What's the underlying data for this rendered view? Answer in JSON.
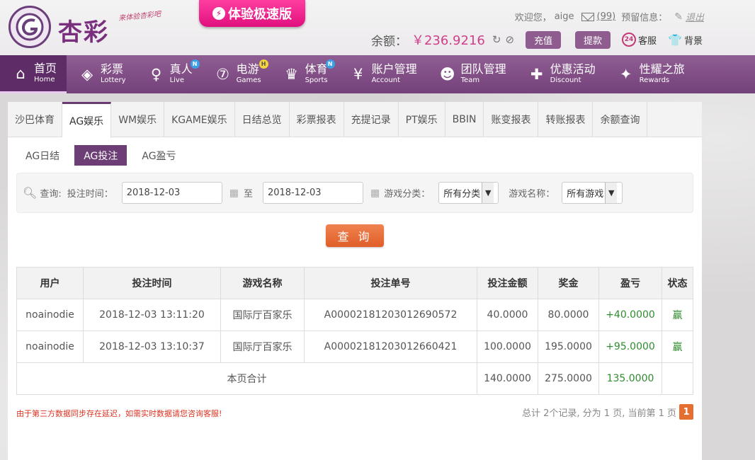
{
  "header": {
    "brand": "杏彩",
    "slogan": "来体验杏彩吧",
    "promo": "体验极速版",
    "welcome": "欢迎您，",
    "username": "aige",
    "mail_count": "(99)",
    "reserve_label": "预留信息：",
    "logout": "退出",
    "balance_label": "余额：",
    "balance_value": "￥236.9216",
    "recharge": "充值",
    "withdraw": "提款",
    "service": "客服",
    "background": "背景"
  },
  "nav": [
    {
      "cn": "首页",
      "en": "Home",
      "icon": "home-icon"
    },
    {
      "cn": "彩票",
      "en": "Lottery",
      "icon": "lottery-icon"
    },
    {
      "cn": "真人",
      "en": "Live",
      "icon": "live-icon",
      "badge": "N"
    },
    {
      "cn": "电游",
      "en": "Games",
      "icon": "games-icon",
      "badge": "H"
    },
    {
      "cn": "体育",
      "en": "Sports",
      "icon": "trophy-icon",
      "badge": "N"
    },
    {
      "cn": "账户管理",
      "en": "Account",
      "icon": "yen-icon"
    },
    {
      "cn": "团队管理",
      "en": "Team",
      "icon": "team-icon"
    },
    {
      "cn": "优惠活动",
      "en": "Discount",
      "icon": "gift-icon"
    },
    {
      "cn": "性耀之旅",
      "en": "Rewards",
      "icon": "rewards-icon"
    }
  ],
  "tabs": [
    "沙巴体育",
    "AG娱乐",
    "WM娱乐",
    "KGAME娱乐",
    "日结总览",
    "彩票报表",
    "充提记录",
    "PT娱乐",
    "BBIN",
    "账变报表",
    "转账报表",
    "余额查询"
  ],
  "active_tab": "AG娱乐",
  "subtabs": [
    "AG日结",
    "AG投注",
    "AG盈亏"
  ],
  "active_subtab": "AG投注",
  "filter": {
    "query_label": "查询:",
    "time_label": "投注时间：",
    "date_from": "2018-12-03",
    "to_label": "至",
    "date_to": "2018-12-03",
    "category_label": "游戏分类：",
    "category_value": "所有分类",
    "game_label": "游戏名称：",
    "game_value": "所有游戏",
    "query_button": "查 询"
  },
  "table": {
    "headers": [
      "用户",
      "投注时间",
      "游戏名称",
      "投注单号",
      "投注金额",
      "奖金",
      "盈亏",
      "状态"
    ],
    "rows": [
      [
        "noainodie",
        "2018-12-03 13:11:20",
        "国际厅百家乐",
        "A00002181203012690572",
        "40.0000",
        "80.0000",
        "+40.0000",
        "赢"
      ],
      [
        "noainodie",
        "2018-12-03 13:10:37",
        "国际厅百家乐",
        "A00002181203012660421",
        "100.0000",
        "195.0000",
        "+95.0000",
        "赢"
      ]
    ],
    "total_label": "本页合计",
    "total_bet": "140.0000",
    "total_prize": "275.0000",
    "total_profit": "135.0000"
  },
  "note": "由于第三方数据同步存在延迟，如需实时数据请您咨询客服!",
  "pager": {
    "summary": "总计 2个记录, 分为 1 页, 当前第 1 页",
    "current": "1"
  },
  "colors": {
    "brand": "#7a2f7e",
    "nav": "#845088",
    "accent": "#e56f31",
    "win": "#2f8c2f"
  }
}
